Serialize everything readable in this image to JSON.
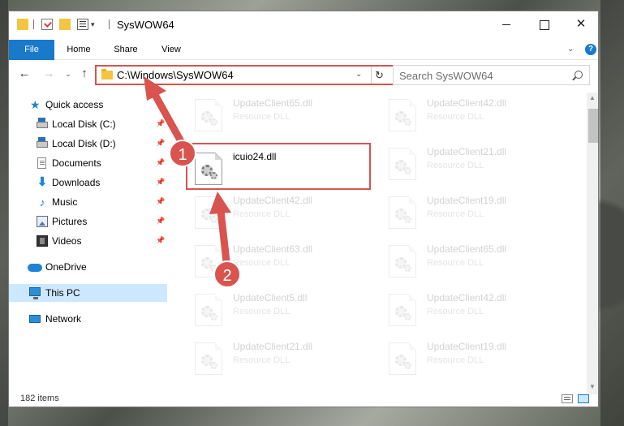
{
  "window": {
    "title": "SysWOW64"
  },
  "ribbon": {
    "tabs": [
      {
        "label": "File"
      },
      {
        "label": "Home"
      },
      {
        "label": "Share"
      },
      {
        "label": "View"
      }
    ],
    "help_label": "?"
  },
  "navigation": {
    "address": "C:\\Windows\\SysWOW64",
    "search_placeholder": "Search SysWOW64"
  },
  "sidebar": {
    "items": [
      {
        "label": "Quick access",
        "icon": "star-icon"
      },
      {
        "label": "Local Disk (C:)",
        "icon": "disk-icon",
        "pinned": true
      },
      {
        "label": "Local Disk (D:)",
        "icon": "disk-icon",
        "pinned": true
      },
      {
        "label": "Documents",
        "icon": "documents-icon",
        "pinned": true
      },
      {
        "label": "Downloads",
        "icon": "downloads-icon",
        "pinned": true
      },
      {
        "label": "Music",
        "icon": "music-icon",
        "pinned": true
      },
      {
        "label": "Pictures",
        "icon": "pictures-icon",
        "pinned": true
      },
      {
        "label": "Videos",
        "icon": "videos-icon",
        "pinned": true
      },
      {
        "label": "OneDrive",
        "icon": "cloud-icon"
      },
      {
        "label": "This PC",
        "icon": "computer-icon",
        "selected": true
      },
      {
        "label": "Network",
        "icon": "network-icon"
      }
    ]
  },
  "files": [
    {
      "name": "UpdateClient65.dll",
      "type": "Resource DLL"
    },
    {
      "name": "UpdateClient42.dll",
      "type": "Resource DLL"
    },
    {
      "name": "icuio24.dll",
      "type": "",
      "active": true
    },
    {
      "name": "UpdateClient21.dll",
      "type": "Resource DLL"
    },
    {
      "name": "UpdateClient42.dll",
      "type": "Resource DLL"
    },
    {
      "name": "UpdateClient19.dll",
      "type": "Resource DLL"
    },
    {
      "name": "UpdateClient63.dll",
      "type": "Resource DLL"
    },
    {
      "name": "UpdateClient65.dll",
      "type": "Resource DLL"
    },
    {
      "name": "UpdateClient5.dll",
      "type": "Resource DLL"
    },
    {
      "name": "UpdateClient42.dll",
      "type": "Resource DLL"
    },
    {
      "name": "UpdateClient21.dll",
      "type": "Resource DLL"
    },
    {
      "name": "UpdateClient19.dll",
      "type": "Resource DLL"
    }
  ],
  "status": {
    "item_count": "182 items"
  },
  "annotations": {
    "badge_1": "1",
    "badge_2": "2",
    "color": "#d9534f"
  }
}
